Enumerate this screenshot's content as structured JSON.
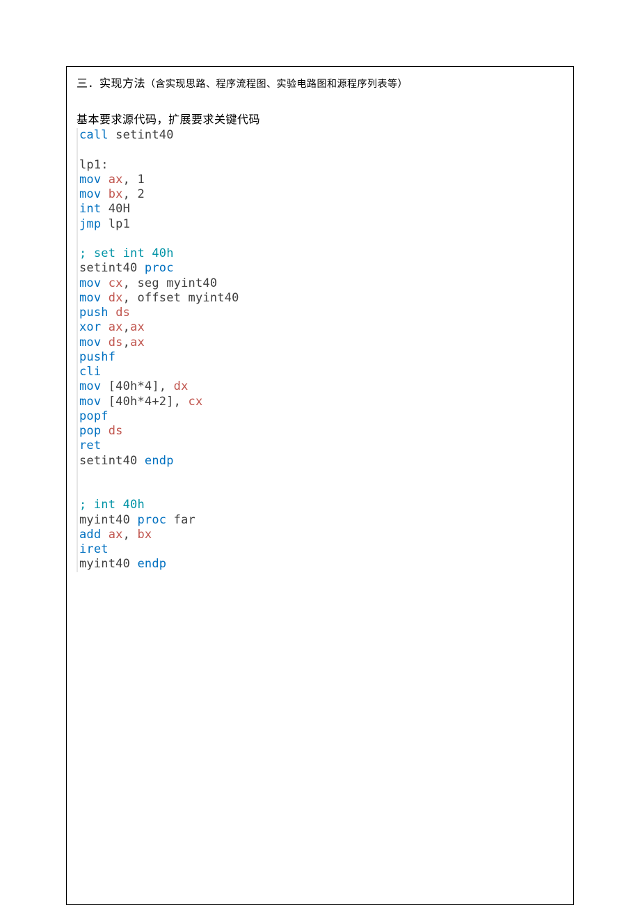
{
  "heading_main": "三．实现方法",
  "heading_paren": "（含实现思路、程序流程图、实验电路图和源程序列表等）",
  "subheading": "基本要求源代码，扩展要求关键代码",
  "code": {
    "lines": [
      [
        {
          "cls": "kw",
          "t": "call"
        },
        {
          "cls": "txt",
          "t": " setint40"
        }
      ],
      [],
      [
        {
          "cls": "lbl",
          "t": "lp1:"
        }
      ],
      [
        {
          "cls": "kw",
          "t": "mov"
        },
        {
          "cls": "txt",
          "t": " "
        },
        {
          "cls": "reg",
          "t": "ax"
        },
        {
          "cls": "txt",
          "t": ", 1"
        }
      ],
      [
        {
          "cls": "kw",
          "t": "mov"
        },
        {
          "cls": "txt",
          "t": " "
        },
        {
          "cls": "reg",
          "t": "bx"
        },
        {
          "cls": "txt",
          "t": ", 2"
        }
      ],
      [
        {
          "cls": "kw",
          "t": "int"
        },
        {
          "cls": "txt",
          "t": " 40H"
        }
      ],
      [
        {
          "cls": "kw",
          "t": "jmp"
        },
        {
          "cls": "txt",
          "t": " lp1"
        }
      ],
      [],
      [
        {
          "cls": "cmt",
          "t": "; set int 40h"
        }
      ],
      [
        {
          "cls": "txt",
          "t": "setint40 "
        },
        {
          "cls": "kw",
          "t": "proc"
        }
      ],
      [
        {
          "cls": "kw",
          "t": "mov"
        },
        {
          "cls": "txt",
          "t": " "
        },
        {
          "cls": "reg",
          "t": "cx"
        },
        {
          "cls": "txt",
          "t": ", seg myint40"
        }
      ],
      [
        {
          "cls": "kw",
          "t": "mov"
        },
        {
          "cls": "txt",
          "t": " "
        },
        {
          "cls": "reg",
          "t": "dx"
        },
        {
          "cls": "txt",
          "t": ", offset myint40"
        }
      ],
      [
        {
          "cls": "kw",
          "t": "push"
        },
        {
          "cls": "txt",
          "t": " "
        },
        {
          "cls": "reg",
          "t": "ds"
        }
      ],
      [
        {
          "cls": "kw",
          "t": "xor"
        },
        {
          "cls": "txt",
          "t": " "
        },
        {
          "cls": "reg",
          "t": "ax"
        },
        {
          "cls": "txt",
          "t": ","
        },
        {
          "cls": "reg",
          "t": "ax"
        }
      ],
      [
        {
          "cls": "kw",
          "t": "mov"
        },
        {
          "cls": "txt",
          "t": " "
        },
        {
          "cls": "reg",
          "t": "ds"
        },
        {
          "cls": "txt",
          "t": ","
        },
        {
          "cls": "reg",
          "t": "ax"
        }
      ],
      [
        {
          "cls": "kw",
          "t": "pushf"
        }
      ],
      [
        {
          "cls": "kw",
          "t": "cli"
        }
      ],
      [
        {
          "cls": "kw",
          "t": "mov"
        },
        {
          "cls": "txt",
          "t": " [40h*4], "
        },
        {
          "cls": "reg",
          "t": "dx"
        }
      ],
      [
        {
          "cls": "kw",
          "t": "mov"
        },
        {
          "cls": "txt",
          "t": " [40h*4+2], "
        },
        {
          "cls": "reg",
          "t": "cx"
        }
      ],
      [
        {
          "cls": "kw",
          "t": "popf"
        }
      ],
      [
        {
          "cls": "kw",
          "t": "pop"
        },
        {
          "cls": "txt",
          "t": " "
        },
        {
          "cls": "reg",
          "t": "ds"
        }
      ],
      [
        {
          "cls": "kw",
          "t": "ret"
        }
      ],
      [
        {
          "cls": "txt",
          "t": "setint40 "
        },
        {
          "cls": "kw",
          "t": "endp"
        }
      ],
      [],
      [],
      [
        {
          "cls": "cmt",
          "t": "; int 40h"
        }
      ],
      [
        {
          "cls": "txt",
          "t": "myint40 "
        },
        {
          "cls": "kw",
          "t": "proc"
        },
        {
          "cls": "txt",
          "t": " far"
        }
      ],
      [
        {
          "cls": "kw",
          "t": "add"
        },
        {
          "cls": "txt",
          "t": " "
        },
        {
          "cls": "reg",
          "t": "ax"
        },
        {
          "cls": "txt",
          "t": ", "
        },
        {
          "cls": "reg",
          "t": "bx"
        }
      ],
      [
        {
          "cls": "kw",
          "t": "iret"
        }
      ],
      [
        {
          "cls": "txt",
          "t": "myint40 "
        },
        {
          "cls": "kw",
          "t": "endp"
        }
      ]
    ]
  }
}
